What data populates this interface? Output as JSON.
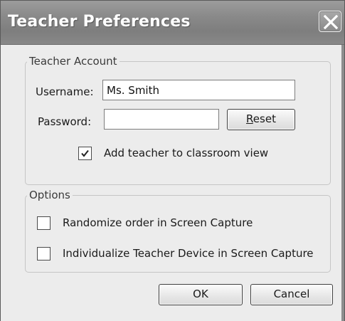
{
  "window": {
    "title": "Teacher Preferences",
    "close_icon": "close-icon"
  },
  "account_group": {
    "legend": "Teacher Account",
    "username_label": "Username:",
    "username_value": "Ms. Smith",
    "password_label": "Password:",
    "password_value": "",
    "reset_label_mnemonic": "R",
    "reset_label_rest": "eset",
    "add_teacher_label": "Add teacher to classroom view",
    "add_teacher_checked": true
  },
  "options_group": {
    "legend": "Options",
    "randomize_label": "Randomize order in Screen Capture",
    "randomize_checked": false,
    "individualize_label": "Individualize Teacher Device in Screen Capture",
    "individualize_checked": false
  },
  "buttons": {
    "ok_label": "OK",
    "cancel_label": "Cancel"
  },
  "colors": {
    "titlebar": "#8a8a8a",
    "dialog_background": "#ececec"
  }
}
